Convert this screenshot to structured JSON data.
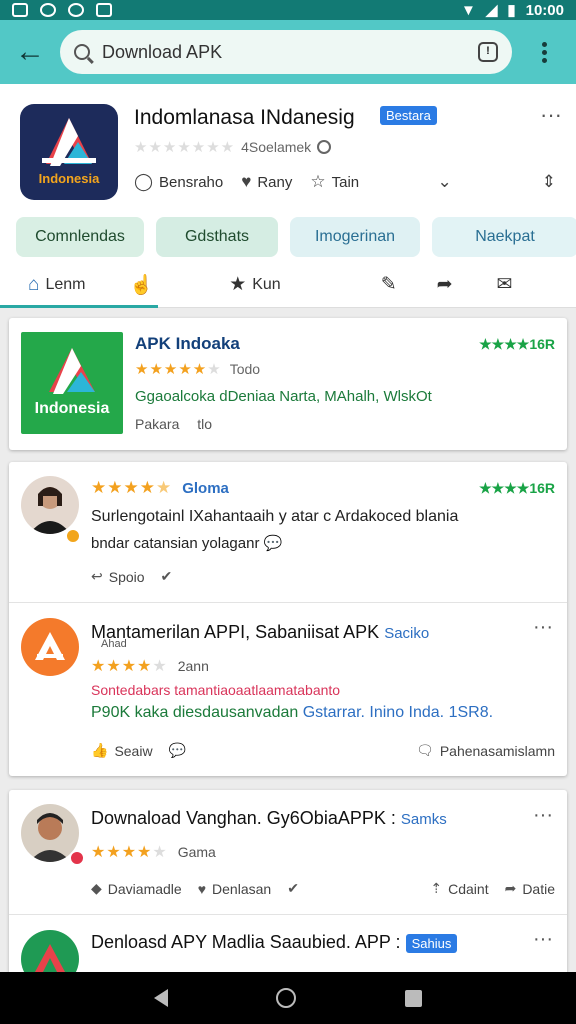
{
  "status_bar": {
    "time": "10:00"
  },
  "search": {
    "query": "Download APK"
  },
  "app": {
    "title": "Indomlanasa INdanesig",
    "badge": "Bestara",
    "rating_count": "4Soelamek",
    "icon_brand": "Indonesia",
    "actions": [
      "Bensraho",
      "Rany",
      "Tain"
    ]
  },
  "chips": [
    {
      "label": "Comnlendas",
      "bg": "#d9efe4",
      "color": "#1f4b2e"
    },
    {
      "label": "Gdsthats",
      "bg": "#d5ede3",
      "color": "#1f4b2e"
    },
    {
      "label": "Imogerinan",
      "bg": "#dff1f3",
      "color": "#2a6f93"
    },
    {
      "label": "Naekpat",
      "bg": "#e2f3f5",
      "color": "#2a6f93"
    }
  ],
  "tabs": {
    "home": "Lenm",
    "star": "Kun"
  },
  "featured": {
    "title": "APK Indoaka",
    "rating": "16R",
    "subtitle": "Todo",
    "description": "Ggaoalcoka dDeniaa Narta, MAhalh, WlskOt",
    "package": "Pakara",
    "package_extra": "tlo",
    "icon_brand": "Indonesia"
  },
  "reviews_card1": {
    "r1": {
      "label": "Gloma",
      "rating": "16R",
      "line1": "Surlengotainl IXahantaaih y atar c Ardakoced blania",
      "line2": "bndar catansian yolaganr",
      "footer": "Spoio"
    },
    "r2": {
      "title": "Mantamerilan APPI, Sabaniisat APK",
      "title_link": "Saciko",
      "sub_title": "Ahad",
      "time": "2ann",
      "red_line": "Sontedabars tamantiaoaatlaamatabanto",
      "green_line": "P90K kaka diesdausanvadan",
      "green_link": "Gstarrar. Inino Inda. 1SR8.",
      "footer_left": "Seaiw",
      "footer_right": "Pahenasamislamn"
    }
  },
  "reviews_card2": {
    "r3": {
      "title": "Downaload Vanghan. Gy6ObiaAPPK :",
      "title_link": "Samks",
      "time": "Gama",
      "footer": [
        "Daviamadle",
        "Denlasan",
        "Cdaint",
        "Datie"
      ]
    },
    "r4": {
      "title": "Denloasd APY Madlia Saaubied. APP :",
      "badge": "Sahius"
    }
  },
  "colors": {
    "teal_bar": "#52c8c6",
    "status": "#127a74",
    "accent": "#2aa8a4",
    "star": "#f3a11f",
    "green": "#19a346"
  }
}
